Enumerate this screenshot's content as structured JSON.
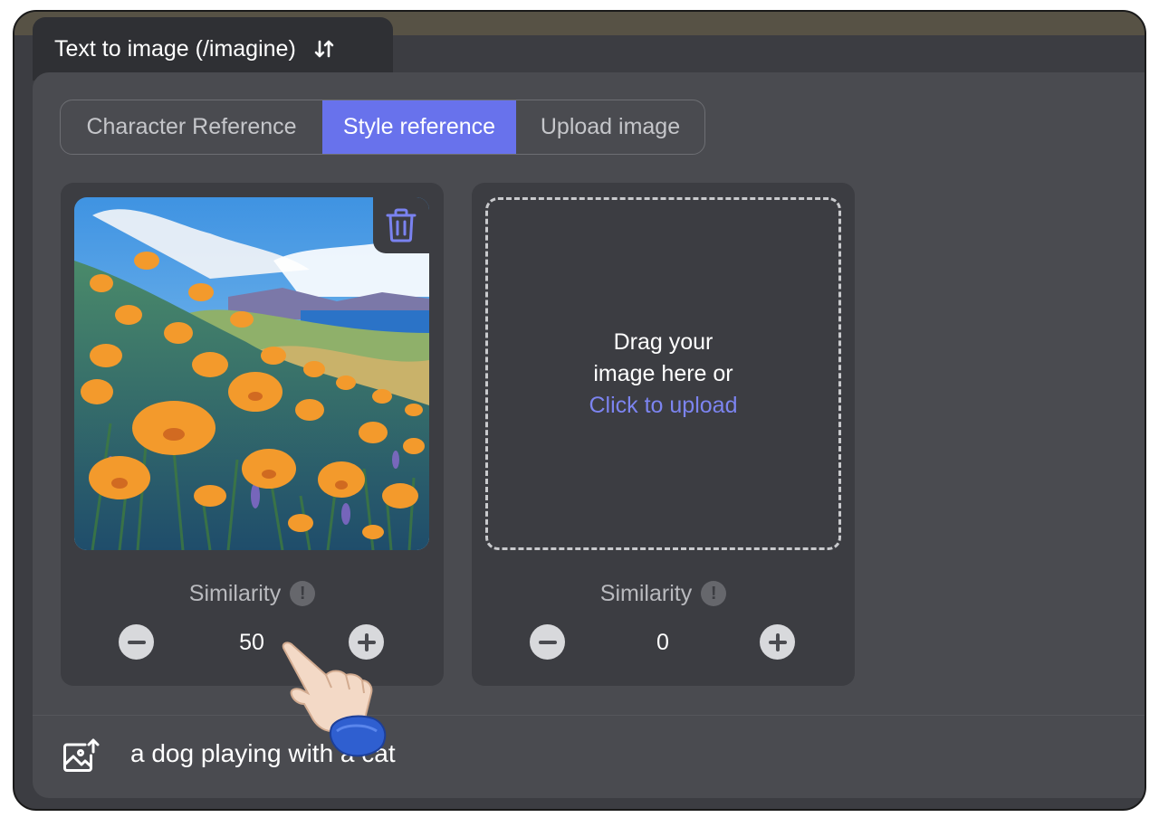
{
  "header": {
    "mode_tab_label": "Text to image (/imagine)",
    "swap_icon": "swap-vertical-icon"
  },
  "reference_tabs": [
    {
      "label": "Character Reference",
      "active": false
    },
    {
      "label": "Style reference",
      "active": true
    },
    {
      "label": "Upload image",
      "active": false
    }
  ],
  "cards": [
    {
      "image": "orange-poppy-field-painting",
      "delete_icon": "trash-icon",
      "similarity_label": "Similarity",
      "info_icon": "exclamation-info-icon",
      "info_glyph": "!",
      "value": "50"
    },
    {
      "dropzone": {
        "line1": "Drag your",
        "line2": "image here or",
        "link": "Click to upload"
      },
      "similarity_label": "Similarity",
      "info_icon": "exclamation-info-icon",
      "info_glyph": "!",
      "value": "0"
    }
  ],
  "prompt": {
    "icon": "image-upload-icon",
    "text": "a dog playing with a cat"
  },
  "cursor": "pointing-hand-icon",
  "colors": {
    "accent": "#6872ec",
    "link": "#7c84f0",
    "panel": "#4a4b50",
    "card": "#3c3d42"
  }
}
